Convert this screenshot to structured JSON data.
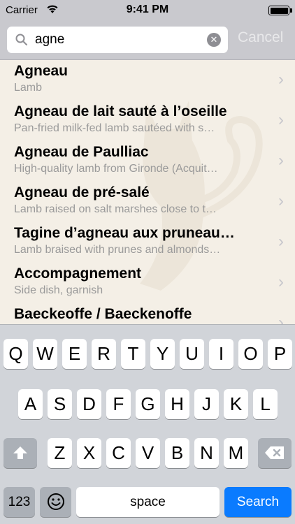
{
  "status_bar": {
    "carrier": "Carrier",
    "time": "9:41 PM",
    "battery_level": 1.0
  },
  "search": {
    "query": "agne",
    "clear_icon": "clear-icon",
    "cancel_label": "Cancel"
  },
  "results": [
    {
      "title": "Agneau",
      "subtitle": "Lamb"
    },
    {
      "title": "Agneau de lait sauté à l’oseille",
      "subtitle": "Pan-fried milk-fed lamb sautéed with s…"
    },
    {
      "title": "Agneau de Paulliac",
      "subtitle": "High-quality lamb from Gironde (Acquit…"
    },
    {
      "title": "Agneau de pré-salé",
      "subtitle": "Lamb raised on salt marshes close to t…"
    },
    {
      "title": "Tagine d’agneau aux pruneau…",
      "subtitle": "Lamb braised with prunes and almonds…"
    },
    {
      "title": "Accompagnement",
      "subtitle": "Side dish, garnish"
    },
    {
      "title": "Baeckeoffe / Baeckenoffe",
      "subtitle": ""
    }
  ],
  "keyboard": {
    "row1": [
      "Q",
      "W",
      "E",
      "R",
      "T",
      "Y",
      "U",
      "I",
      "O",
      "P"
    ],
    "row2": [
      "A",
      "S",
      "D",
      "F",
      "G",
      "H",
      "J",
      "K",
      "L"
    ],
    "row3": [
      "Z",
      "X",
      "C",
      "V",
      "B",
      "N",
      "M"
    ],
    "numbers_label": "123",
    "space_label": "space",
    "search_label": "Search"
  },
  "colors": {
    "accent": "#0a7bff",
    "bar": "#c9c9ce",
    "background": "#f4efe6"
  }
}
